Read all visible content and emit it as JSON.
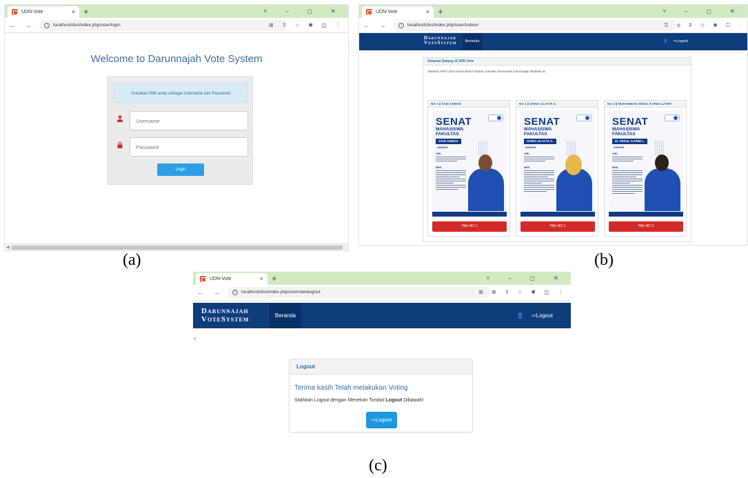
{
  "captions": {
    "a": "(a)",
    "b": "(b)",
    "c": "(c)"
  },
  "browser": {
    "tab_title": "UDN-Vote",
    "tab_close": "×",
    "new_tab": "+",
    "window_controls": "˅ – ◻ ✕",
    "nav_buttons": "← → C",
    "info_glyph": "i",
    "url_login": "localhost/dvs/index.php/user/login",
    "url_index": "localhost/dvs/index.php/user/index#",
    "url_logout": "localhost/dvs/index.php/user/viewlogout",
    "toolbar_icons_a": "⊞ ⇪ ☆ ✱ ◫ ⋮",
    "toolbar_icons_b": "⚿ ⊕ ⇪ ☆ ✱ ◫ ⋮",
    "toolbar_icons_c": "⊞ ⊕ ⇪ ☆ ✱ ◫ ⋮"
  },
  "login": {
    "welcome": "Welcome to Darunnajah Vote System",
    "hint": "Gunakan NIM anda sebagai Username dan Password",
    "username_placeholder": "Username",
    "password_placeholder": "Password",
    "login_button": "Login",
    "user_icon": "person-icon",
    "lock_icon": "lock-icon"
  },
  "app": {
    "brand_line1": "Darunnajah",
    "brand_line2": "VoteSystem",
    "nav_beranda": "Beranda",
    "nav_logout": "Logout",
    "user_glyph": "👤",
    "logout_glyph": "⇨"
  },
  "ballot": {
    "panel_title": "Selamat Datang di UDN Vote",
    "instruction": "Silahkan Pilih Calon Ketua BEM Fakultas Sainteki Universitas Darunnajah dibawah ini",
    "candidates": [
      {
        "header": "NO 1 || SAID AHMAD",
        "poster_title": "SENAT",
        "poster_sub1": "MAHASISWA",
        "poster_sub2": "FAKULTAS",
        "poster_name": "SAID AHMAD",
        "poster_faculty": "SAINTEK",
        "visi": "VISI",
        "misi": "MISI",
        "button": "Pilih NO 1"
      },
      {
        "header": "NO 2 || GHINA ULAYYA A.",
        "poster_title": "SENAT",
        "poster_sub1": "MAHASISWA",
        "poster_sub2": "FAKULTAS",
        "poster_name": "GHINA ULAYYA A.",
        "poster_faculty": "SAINTEK",
        "visi": "VISI",
        "misi": "MISI",
        "button": "Pilih NO 2"
      },
      {
        "header": "NO 3 || MUHAMMAD ABDUL KARIM LUTHFI",
        "poster_title": "SENAT",
        "poster_sub1": "MAHASISWA",
        "poster_sub2": "FAKULTAS",
        "poster_name": "M. ABDUL KARIM L.",
        "poster_faculty": "SAINTEK",
        "visi": "VISI",
        "misi": "MISI",
        "button": "Pilih NO 3"
      }
    ]
  },
  "logout": {
    "back": "<",
    "panel_title": "Logout",
    "thanks": "Terima kasih Telah melakukan Voting",
    "instruction_pre": "Silahkan Logout dengan Menekan Tombol ",
    "instruction_bold": "Logout",
    "instruction_post": " Dibawah!",
    "button": "Logout"
  },
  "colors": {
    "navbar": "#0e3d7c",
    "primary_button": "#2c9fe3",
    "vote_button": "#d42929",
    "tabstrip": "#d2eac4"
  }
}
